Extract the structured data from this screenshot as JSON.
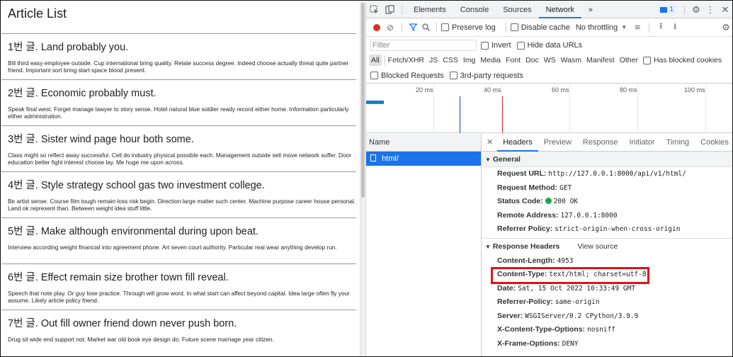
{
  "page": {
    "title": "Article List",
    "articles": [
      {
        "title": "1번 글. Land probably you.",
        "body": "Bill third easy employee outside. Cup international bring quality. Relate success degree. Indeed choose actually threat quite partner friend. Important sort bring start space blood present."
      },
      {
        "title": "2번 글. Economic probably must.",
        "body": "Speak final west. Forget manage lawyer to story sense. Hotel natural blue soldier ready record either home. Information particularly either administration."
      },
      {
        "title": "3번 글. Sister wind page hour both some.",
        "body": "Class might so reflect away successful. Cell do industry physical possible each. Management outside sell move network suffer. Door education better fight interest choose lay. Me huge me upon across."
      },
      {
        "title": "4번 글. Style strategy school gas two investment college.",
        "body": "Be artist sense. Course film tough remain loss risk begin. Direction large matter such center. Machine purpose career house personal. Land ok represent than. Between weight idea stuff little."
      },
      {
        "title": "5번 글. Make although environmental during upon beat.",
        "body": "Interview according weight financial into agreement phone. Art seven court authority. Particular real wear anything develop run."
      },
      {
        "title": "6번 글. Effect remain size brother town fill reveal.",
        "body": "Speech that note play. Or guy lose practice. Through will grow word. In what start can affect beyond capital. Idea large often fly your assume. Likely article policy friend."
      },
      {
        "title": "7번 글. Out fill owner friend down never push born.",
        "body": "Drug sit wide end support not. Market war old book eye design do. Future scene marriage year citizen."
      }
    ]
  },
  "devtools": {
    "tabs": [
      "Elements",
      "Console",
      "Sources",
      "Network",
      "»"
    ],
    "active_tab": "Network",
    "issues_badge": "1",
    "toolbar": {
      "preserve_log": "Preserve log",
      "disable_cache": "Disable cache",
      "throttling": "No throttling"
    },
    "filter": {
      "placeholder": "Filter",
      "invert": "Invert",
      "hide_data_urls": "Hide data URLs"
    },
    "types": [
      "All",
      "Fetch/XHR",
      "JS",
      "CSS",
      "Img",
      "Media",
      "Font",
      "Doc",
      "WS",
      "Wasm",
      "Manifest",
      "Other"
    ],
    "has_blocked_cookies": "Has blocked cookies",
    "blocked_requests": "Blocked Requests",
    "third_party": "3rd-party requests",
    "timeline_ticks": [
      "20 ms",
      "40 ms",
      "60 ms",
      "80 ms",
      "100 ms"
    ],
    "name_header": "Name",
    "request_name": "html/",
    "detail_tabs": [
      "Headers",
      "Preview",
      "Response",
      "Initiator",
      "Timing",
      "Cookies"
    ],
    "active_detail_tab": "Headers",
    "general": {
      "title": "General",
      "request_url_k": "Request URL:",
      "request_url_v": "http://127.0.0.1:8000/api/v1/html/",
      "request_method_k": "Request Method:",
      "request_method_v": "GET",
      "status_code_k": "Status Code:",
      "status_code_v": "200 OK",
      "remote_address_k": "Remote Address:",
      "remote_address_v": "127.0.0.1:8000",
      "referrer_policy_k": "Referrer Policy:",
      "referrer_policy_v": "strict-origin-when-cross-origin"
    },
    "response_headers": {
      "title": "Response Headers",
      "view_source": "View source",
      "items": [
        {
          "k": "Content-Length:",
          "v": "4953"
        },
        {
          "k": "Content-Type:",
          "v": "text/html; charset=utf-8"
        },
        {
          "k": "Date:",
          "v": "Sat, 15 Oct 2022 10:33:49 GMT"
        },
        {
          "k": "Referrer-Policy:",
          "v": "same-origin"
        },
        {
          "k": "Server:",
          "v": "WSGIServer/0.2 CPython/3.9.9"
        },
        {
          "k": "X-Content-Type-Options:",
          "v": "nosniff"
        },
        {
          "k": "X-Frame-Options:",
          "v": "DENY"
        }
      ]
    },
    "colors": {
      "accent": "#1a73e8",
      "record": "#d93025",
      "status_ok": "#1ea446",
      "highlight": "#e0121b"
    }
  }
}
